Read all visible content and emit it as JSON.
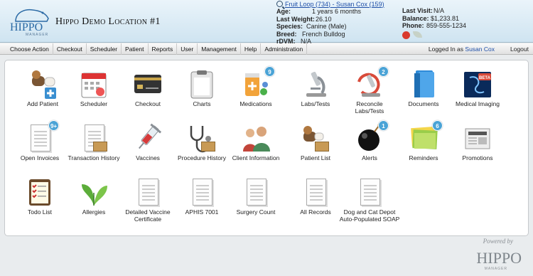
{
  "header": {
    "logo_text": "HIPPO",
    "logo_sub": "MANAGER",
    "location": "Hippo Demo Location #1"
  },
  "patient": {
    "link_text": "Fruit Loop (734) - Susan Cox (159)",
    "age_label": "Age:",
    "age": "1 years 6 months",
    "weight_label": "Last Weight:",
    "weight": "26.10",
    "species_label": "Species:",
    "species": "Canine (Male)",
    "breed_label": "Breed:",
    "breed": "French Bulldog",
    "rdvm_label": "rDVM:",
    "rdvm": "N/A"
  },
  "stats": {
    "visit_label": "Last Visit:",
    "visit": "N/A",
    "balance_label": "Balance:",
    "balance": "$1,233.81",
    "phone_label": "Phone:",
    "phone": "859-555-1234"
  },
  "menu": [
    "Choose Action",
    "Checkout",
    "Scheduler",
    "Patient",
    "Reports",
    "User",
    "Management",
    "Help",
    "Administration"
  ],
  "login": {
    "prefix": "Logged In as",
    "user": "Susan Cox",
    "logout": "Logout"
  },
  "tiles": [
    {
      "label": "Add Patient",
      "icon": "add-patient-icon"
    },
    {
      "label": "Scheduler",
      "icon": "calendar-icon"
    },
    {
      "label": "Checkout",
      "icon": "credit-card-icon"
    },
    {
      "label": "Charts",
      "icon": "clipboard-icon"
    },
    {
      "label": "Medications",
      "icon": "medications-icon",
      "badge": "9"
    },
    {
      "label": "Labs/Tests",
      "icon": "microscope-icon"
    },
    {
      "label": "Reconcile Labs/Tests",
      "icon": "reconcile-microscope-icon",
      "badge": "2"
    },
    {
      "label": "Documents",
      "icon": "folder-icon"
    },
    {
      "label": "Medical Imaging",
      "icon": "xray-icon"
    },
    {
      "label": "Open Invoices",
      "icon": "invoice-icon",
      "badge": "9+"
    },
    {
      "label": "Transaction History",
      "icon": "transaction-history-icon"
    },
    {
      "label": "Vaccines",
      "icon": "syringe-icon"
    },
    {
      "label": "Procedure History",
      "icon": "stethoscope-icon"
    },
    {
      "label": "Client Information",
      "icon": "people-icon"
    },
    {
      "label": "Patient List",
      "icon": "patient-list-icon"
    },
    {
      "label": "Alerts",
      "icon": "bomb-icon",
      "badge": "1"
    },
    {
      "label": "Reminders",
      "icon": "sticky-notes-icon",
      "badge": "6"
    },
    {
      "label": "Promotions",
      "icon": "newspaper-icon"
    },
    {
      "label": "Todo List",
      "icon": "todo-list-icon"
    },
    {
      "label": "Allergies",
      "icon": "leaves-icon"
    },
    {
      "label": "Detailed Vaccine Certificate",
      "icon": "report-icon"
    },
    {
      "label": "APHIS 7001",
      "icon": "report-icon"
    },
    {
      "label": "Surgery Count",
      "icon": "report-icon"
    },
    {
      "label": "All Records",
      "icon": "report-icon"
    },
    {
      "label": "Dog and Cat Depot Auto-Populated SOAP",
      "icon": "report-icon"
    }
  ],
  "beta_label": "BETA",
  "footer": {
    "powered": "Powered by",
    "word": "HIPPO",
    "sub": "MANAGER"
  },
  "colors": {
    "accent": "#1e4fa8",
    "badge": "#4aa3d6",
    "header_bg": "#cfe4f1"
  }
}
